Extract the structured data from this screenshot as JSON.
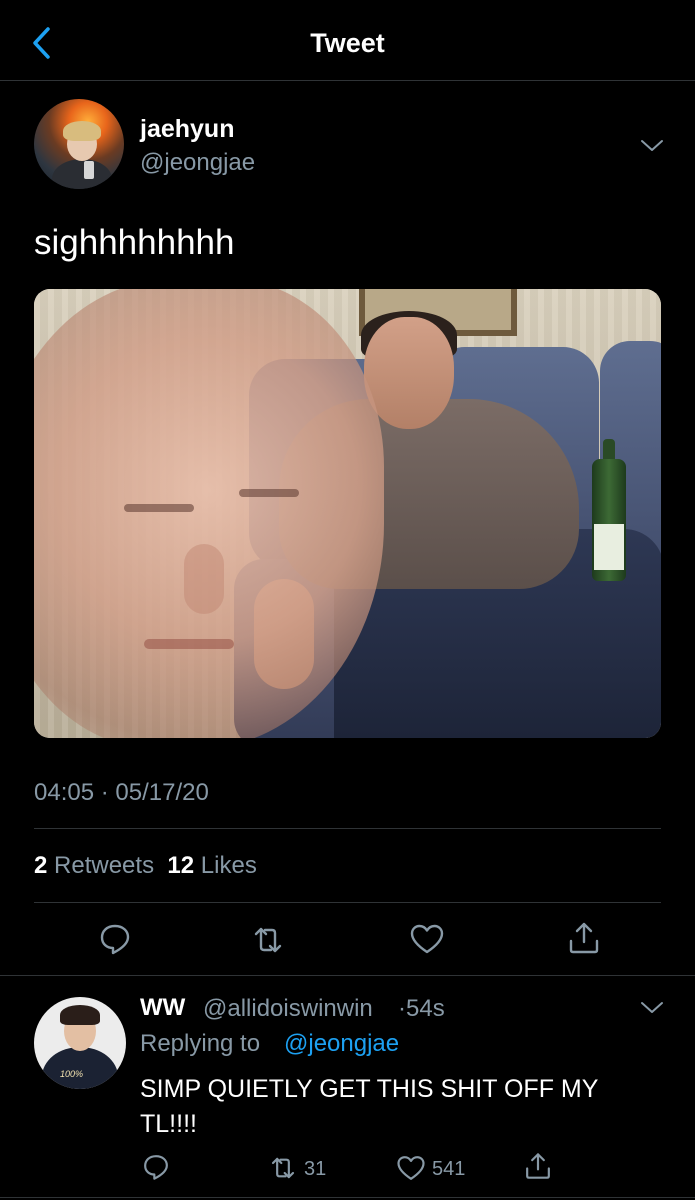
{
  "header": {
    "title": "Tweet"
  },
  "tweet": {
    "author_name": "jaehyun",
    "author_handle": "@jeongjae",
    "text": "sighhhhhhhh",
    "timestamp": "04:05 · 05/17/20",
    "retweet_count": "2",
    "retweet_label": "Retweets",
    "like_count": "12",
    "like_label": "Likes"
  },
  "reply": {
    "author_name": "WW",
    "author_handle": "@allidoiswinwin",
    "separator": "·",
    "time": "54s",
    "replying_prefix": "Replying to",
    "replying_handle": "@jeongjae",
    "text_line1": "SIMP QUIETLY GET THIS SHIT OFF MY",
    "text_line2": "TL!!!!",
    "avatar_print": "100%",
    "retweet_count": "31",
    "like_count": "541"
  },
  "icons": [
    "back-chevron-icon",
    "chevron-down-icon",
    "reply-icon",
    "retweet-icon",
    "like-icon",
    "share-icon"
  ],
  "colors": {
    "background": "#000000",
    "text": "#ffffff",
    "muted": "#8899a6",
    "accent": "#1da1f2",
    "divider": "#2f3336"
  }
}
